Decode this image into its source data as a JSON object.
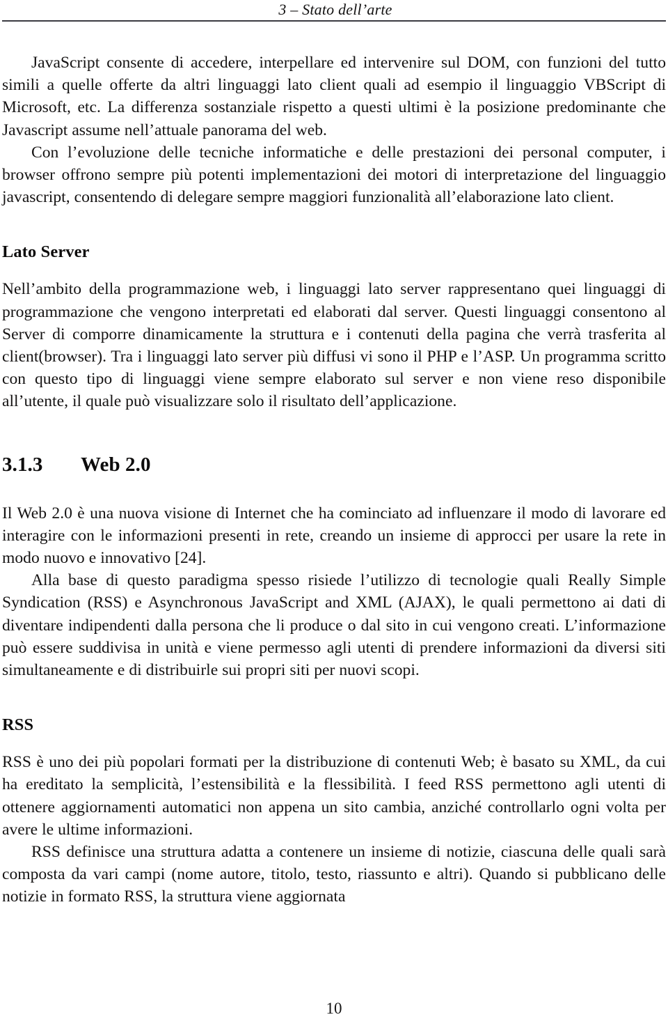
{
  "header": {
    "running_title": "3 – Stato dell’arte"
  },
  "body": {
    "paragraphs": {
      "javascript_dom": "JavaScript consente di accedere, interpellare ed intervenire sul DOM, con funzioni del tutto simili a quelle offerte da altri linguaggi lato client quali ad esempio il linguaggio VBScript di Microsoft, etc. La differenza sostanziale rispetto a questi ultimi è la posizione predominante che Javascript assume nell’attuale panorama del web.",
      "evoluzione_tecniche": "Con l’evoluzione delle tecniche informatiche e delle prestazioni dei personal computer, i browser offrono sempre più potenti implementazioni dei motori di interpretazione del linguaggio javascript, consentendo di delegare sempre maggiori funzionalità all’elaborazione lato client.",
      "lato_server_body": "Nell’ambito della programmazione web, i linguaggi lato server rappresentano quei linguaggi di programmazione che vengono interpretati ed elaborati dal server. Questi linguaggi consentono al Server di comporre dinamicamente la struttura e i contenuti della pagina che verrà trasferita al client(browser). Tra i linguaggi lato server più diffusi vi sono il PHP e l’ASP. Un programma scritto con questo tipo di linguaggi viene sempre elaborato sul server e non viene reso disponibile all’utente, il quale può visualizzare solo il risultato dell’applicazione.",
      "web20_intro": "Il Web 2.0 è una nuova visione di Internet che ha cominciato ad influenzare il modo di lavorare ed interagire con le informazioni presenti in rete, creando un insieme di approcci per usare la rete in modo nuovo e innovativo [24].",
      "web20_paradigma": "Alla base di questo paradigma spesso risiede l’utilizzo di tecnologie quali Really Simple Syndication (RSS) e Asynchronous JavaScript and XML (AJAX), le quali permettono ai dati di diventare indipendenti dalla persona che li produce o dal sito in cui vengono creati. L’informazione può essere suddivisa in unità e viene permesso agli utenti di prendere informazioni da diversi siti simultaneamente e di distribuirle sui propri siti per nuovi scopi.",
      "rss_intro": "RSS è uno dei più popolari formati per la distribuzione di contenuti Web; è basato su XML, da cui ha ereditato la semplicità, l’estensibilità e la flessibilità. I feed RSS permettono agli utenti di ottenere aggiornamenti automatici non appena un sito cambia, anziché controllarlo ogni volta per avere le ultime informazioni.",
      "rss_struttura": "RSS definisce una struttura adatta a contenere un insieme di notizie, ciascuna delle quali sarà composta da vari campi (nome autore, titolo, testo, riassunto e altri). Quando si pubblicano delle notizie in formato RSS, la struttura viene aggiornata"
    },
    "headings": {
      "lato_server": "Lato Server",
      "web20_number": "3.1.3",
      "web20_title": "Web 2.0",
      "rss": "RSS"
    }
  },
  "footer": {
    "page_number": "10"
  }
}
